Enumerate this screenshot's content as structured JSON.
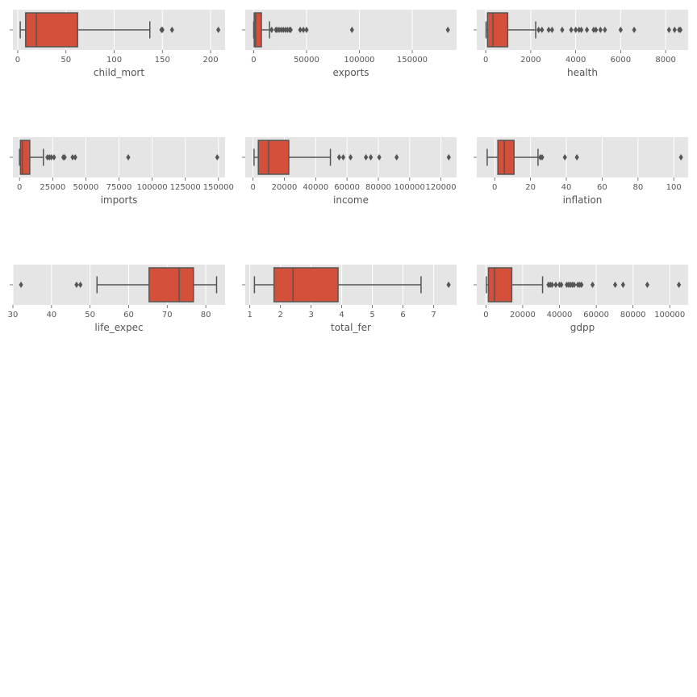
{
  "figure": {
    "background": "#ffffff",
    "panel_color": "#e5e5e5",
    "grid_color": "#ffffff",
    "box_color": "#d4503b",
    "line_color": "#555555"
  },
  "chart_data": [
    {
      "type": "box",
      "orientation": "horizontal",
      "xlabel": "child_mort",
      "xlim": [
        -5,
        215
      ],
      "xticks": [
        0,
        50,
        100,
        150,
        200
      ],
      "xtick_labels": [
        "0",
        "50",
        "100",
        "150",
        "200"
      ],
      "whisker_low": 2.6,
      "q1": 8.2,
      "median": 19.3,
      "q3": 62.1,
      "whisker_high": 137,
      "outliers": [
        149,
        150,
        160,
        208
      ]
    },
    {
      "type": "box",
      "orientation": "horizontal",
      "xlabel": "exports",
      "xlim": [
        -8000,
        192000
      ],
      "xticks": [
        0,
        50000,
        100000,
        150000
      ],
      "xtick_labels": [
        "0",
        "50000",
        "100000",
        "150000"
      ],
      "whisker_low": 1,
      "q1": 447,
      "median": 1777,
      "q3": 7278,
      "whisker_high": 15000,
      "outliers": [
        17000,
        21000,
        22000,
        24000,
        26000,
        28000,
        30000,
        32000,
        34000,
        35000,
        44000,
        47000,
        50000,
        93000,
        183750
      ]
    },
    {
      "type": "box",
      "orientation": "horizontal",
      "xlabel": "health",
      "xlim": [
        -400,
        9000
      ],
      "xticks": [
        0,
        2000,
        4000,
        6000,
        8000
      ],
      "xtick_labels": [
        "0",
        "2000",
        "4000",
        "6000",
        "8000"
      ],
      "whisker_low": 13,
      "q1": 79,
      "median": 322,
      "q3": 976,
      "whisker_high": 2220,
      "outliers": [
        2350,
        2500,
        2800,
        2950,
        3400,
        3800,
        4000,
        4150,
        4250,
        4500,
        4800,
        4900,
        5100,
        5300,
        6000,
        6600,
        8150,
        8400,
        8600,
        8660
      ]
    },
    {
      "type": "box",
      "orientation": "horizontal",
      "xlabel": "imports",
      "xlim": [
        -5000,
        155000
      ],
      "xticks": [
        0,
        25000,
        50000,
        75000,
        100000,
        125000,
        150000
      ],
      "xtick_labels": [
        "0",
        "25000",
        "50000",
        "75000",
        "100000",
        "125000",
        "150000"
      ],
      "whisker_low": 0.7,
      "q1": 640,
      "median": 2045,
      "q3": 7719,
      "whisker_high": 18000,
      "outliers": [
        21000,
        22500,
        24000,
        26000,
        33000,
        34000,
        40000,
        42000,
        82000,
        149100
      ]
    },
    {
      "type": "box",
      "orientation": "horizontal",
      "xlabel": "income",
      "xlim": [
        -5000,
        130000
      ],
      "xticks": [
        0,
        20000,
        40000,
        60000,
        80000,
        100000,
        120000
      ],
      "xtick_labels": [
        "0",
        "20000",
        "40000",
        "60000",
        "80000",
        "100000",
        "120000"
      ],
      "whisker_low": 609,
      "q1": 3355,
      "median": 9960,
      "q3": 22800,
      "whisker_high": 49400,
      "outliers": [
        55000,
        57600,
        62300,
        72100,
        75200,
        80600,
        91700,
        125000
      ]
    },
    {
      "type": "box",
      "orientation": "horizontal",
      "xlabel": "inflation",
      "xlim": [
        -10,
        108
      ],
      "xticks": [
        0,
        20,
        40,
        60,
        80,
        100
      ],
      "xtick_labels": [
        "0",
        "20",
        "40",
        "60",
        "80",
        "100"
      ],
      "whisker_low": -4.2,
      "q1": 1.8,
      "median": 5.4,
      "q3": 10.8,
      "whisker_high": 24.2,
      "outliers": [
        25.5,
        26.5,
        39.2,
        45.9,
        104
      ]
    },
    {
      "type": "box",
      "orientation": "horizontal",
      "xlabel": "life_expec",
      "xlim": [
        30,
        85
      ],
      "xticks": [
        30,
        40,
        50,
        60,
        70,
        80
      ],
      "xtick_labels": [
        "30",
        "40",
        "50",
        "60",
        "70",
        "80"
      ],
      "whisker_low": 51.8,
      "q1": 65.3,
      "median": 73.1,
      "q3": 76.8,
      "whisker_high": 82.8,
      "outliers": [
        32.1,
        46.5,
        47.5
      ]
    },
    {
      "type": "box",
      "orientation": "horizontal",
      "xlabel": "total_fer",
      "xlim": [
        0.85,
        7.75
      ],
      "xticks": [
        1,
        2,
        3,
        4,
        5,
        6,
        7
      ],
      "xtick_labels": [
        "1",
        "2",
        "3",
        "4",
        "5",
        "6",
        "7"
      ],
      "whisker_low": 1.15,
      "q1": 1.79,
      "median": 2.41,
      "q3": 3.88,
      "whisker_high": 6.59,
      "outliers": [
        7.49
      ]
    },
    {
      "type": "box",
      "orientation": "horizontal",
      "xlabel": "gdpp",
      "xlim": [
        -5000,
        110000
      ],
      "xticks": [
        0,
        20000,
        40000,
        60000,
        80000,
        100000
      ],
      "xtick_labels": [
        "0",
        "20000",
        "40000",
        "60000",
        "80000",
        "100000"
      ],
      "whisker_low": 231,
      "q1": 1330,
      "median": 4660,
      "q3": 14050,
      "whisker_high": 30800,
      "outliers": [
        34000,
        35000,
        36000,
        38000,
        40000,
        41000,
        44000,
        45000,
        46000,
        47000,
        48000,
        50000,
        51000,
        52000,
        58000,
        70300,
        74600,
        87800,
        105000
      ]
    }
  ]
}
